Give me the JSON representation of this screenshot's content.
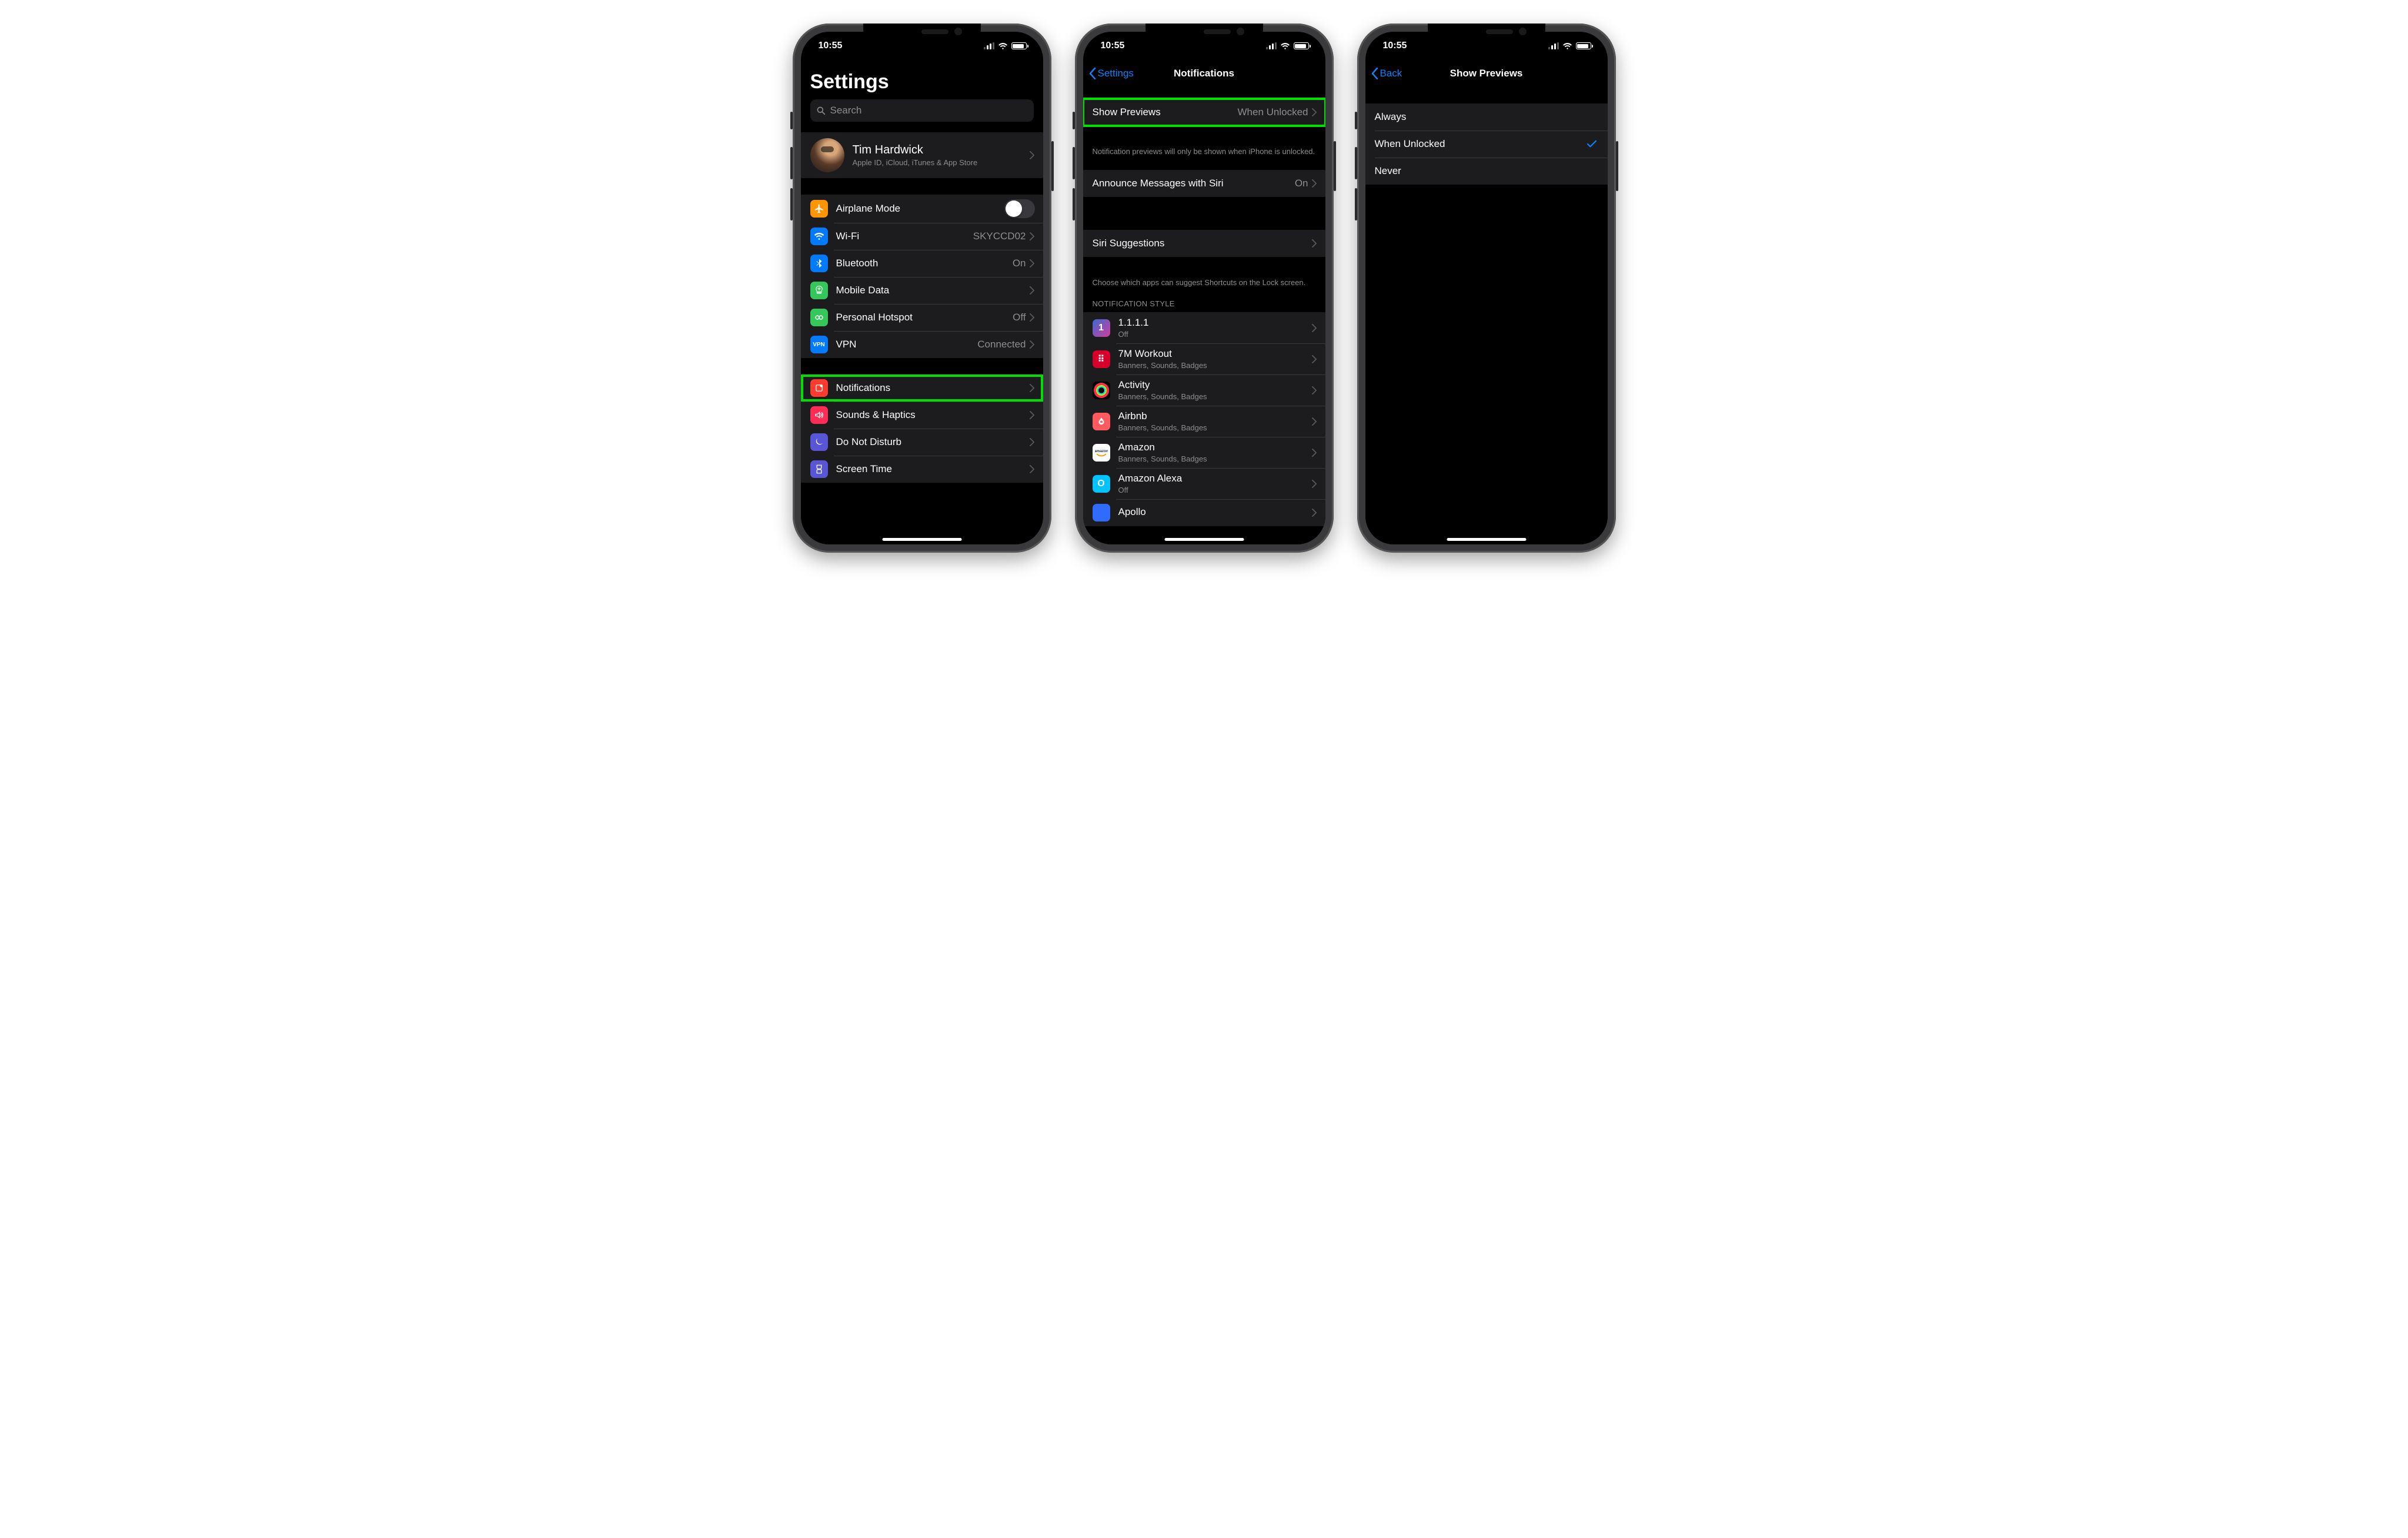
{
  "status": {
    "time": "10:55"
  },
  "screen1": {
    "title": "Settings",
    "search": "Search",
    "profile": {
      "name": "Tim Hardwick",
      "sub": "Apple ID, iCloud, iTunes & App Store"
    },
    "net": {
      "airplane": "Airplane Mode",
      "wifi": {
        "label": "Wi-Fi",
        "value": "SKYCCD02"
      },
      "bluetooth": {
        "label": "Bluetooth",
        "value": "On"
      },
      "mobile": "Mobile Data",
      "hotspot": {
        "label": "Personal Hotspot",
        "value": "Off"
      },
      "vpn": {
        "label": "VPN",
        "value": "Connected"
      }
    },
    "sys": {
      "notifications": "Notifications",
      "sounds": "Sounds & Haptics",
      "dnd": "Do Not Disturb",
      "screentime": "Screen Time"
    }
  },
  "screen2": {
    "back": "Settings",
    "title": "Notifications",
    "previews": {
      "label": "Show Previews",
      "value": "When Unlocked"
    },
    "previews_note": "Notification previews will only be shown when iPhone is unlocked.",
    "announce": {
      "label": "Announce Messages with Siri",
      "value": "On"
    },
    "siri": "Siri Suggestions",
    "siri_note": "Choose which apps can suggest Shortcuts on the Lock screen.",
    "style_header": "Notification Style",
    "apps": [
      {
        "name": "1.1.1.1",
        "sub": "Off"
      },
      {
        "name": "7M Workout",
        "sub": "Banners, Sounds, Badges"
      },
      {
        "name": "Activity",
        "sub": "Banners, Sounds, Badges"
      },
      {
        "name": "Airbnb",
        "sub": "Banners, Sounds, Badges"
      },
      {
        "name": "Amazon",
        "sub": "Banners, Sounds, Badges"
      },
      {
        "name": "Amazon Alexa",
        "sub": "Off"
      },
      {
        "name": "Apollo",
        "sub": ""
      }
    ]
  },
  "screen3": {
    "back": "Back",
    "title": "Show Previews",
    "options": [
      {
        "label": "Always",
        "selected": false
      },
      {
        "label": "When Unlocked",
        "selected": true
      },
      {
        "label": "Never",
        "selected": false
      }
    ]
  }
}
